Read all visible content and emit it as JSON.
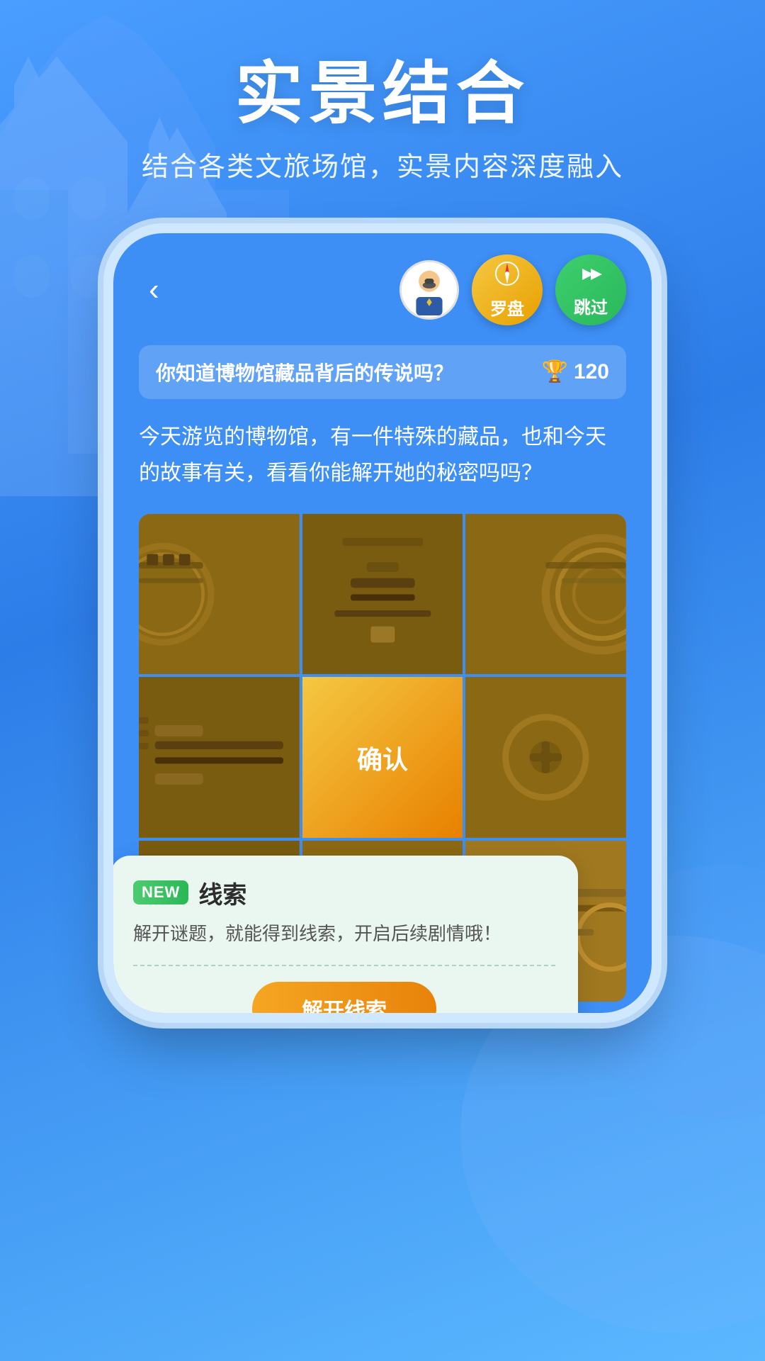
{
  "header": {
    "main_title": "实景结合",
    "sub_title": "结合各类文旅场馆，实景内容深度融入"
  },
  "phone": {
    "back_button": "‹",
    "nav_buttons": {
      "compass_label": "罗盘",
      "skip_label": "跳过"
    },
    "question_bar": {
      "text": "你知道博物馆藏品背后的传说吗？",
      "score": "120",
      "trophy_icon": "🏆"
    },
    "description": "今天游览的博物馆，有一件特殊的藏品，也和今天的故事有关，看看你能解开她的秘密吗吗？",
    "puzzle": {
      "confirm_label": "确认"
    },
    "clue_card": {
      "new_badge": "NEW",
      "title": "线索",
      "desc": "解开谜题，就能得到线索，开启后续剧情哦！",
      "unlock_btn": "解开线索"
    }
  },
  "colors": {
    "bg_gradient_start": "#4a9eff",
    "bg_gradient_end": "#2d7de8",
    "phone_bg": "#3d8ef5",
    "compass_color": "#f5c842",
    "skip_color": "#3ecf6e",
    "confirm_color": "#f5c842",
    "clue_bg": "#eaf6f0",
    "new_badge_color": "#4ecb71",
    "unlock_btn_color": "#f5a623"
  }
}
